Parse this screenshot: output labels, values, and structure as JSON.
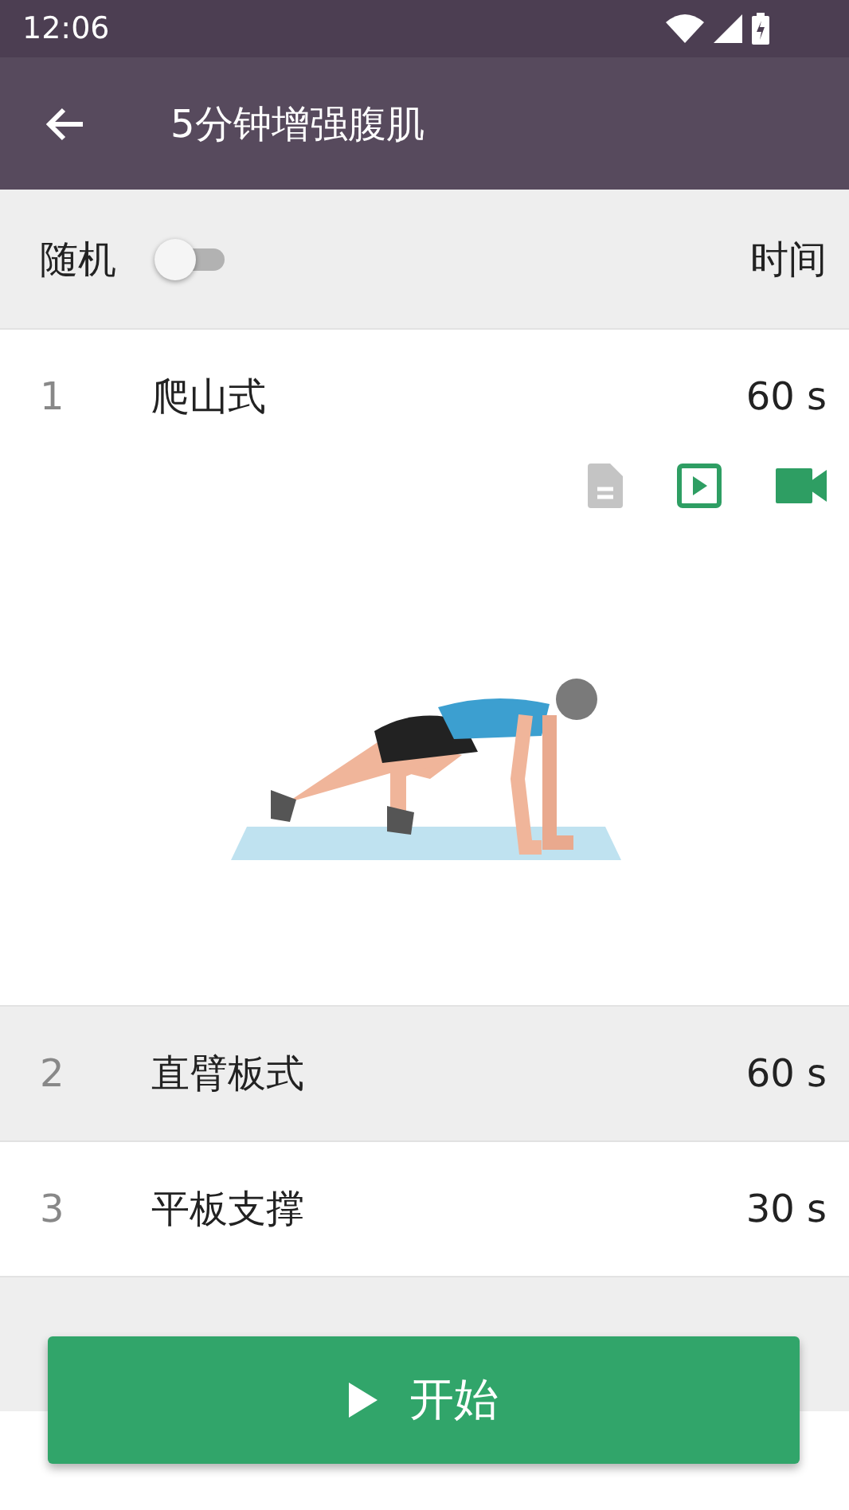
{
  "status_bar": {
    "time": "12:06"
  },
  "app_bar": {
    "title": "5分钟增强腹肌"
  },
  "options": {
    "shuffle_label": "随机",
    "shuffle_on": false,
    "time_label": "时间"
  },
  "exercises": [
    {
      "index": "1",
      "name": "爬山式",
      "duration": "60 s",
      "expanded": true
    },
    {
      "index": "2",
      "name": "直臂板式",
      "duration": "60 s",
      "expanded": false
    },
    {
      "index": "3",
      "name": "平板支撑",
      "duration": "30 s",
      "expanded": false
    }
  ],
  "start_button": {
    "label": "开始"
  }
}
